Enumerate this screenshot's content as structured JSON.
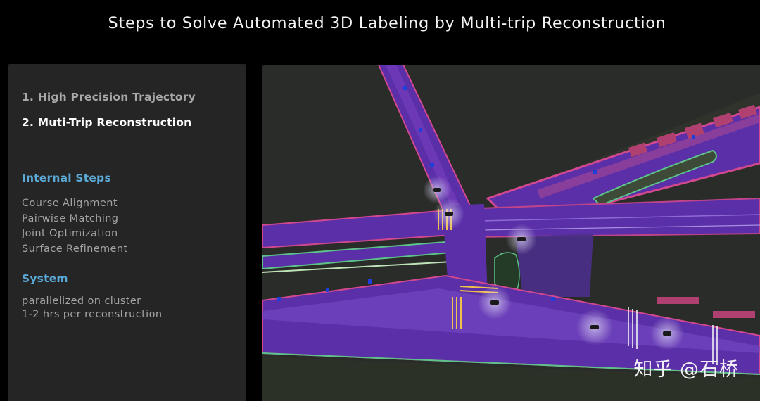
{
  "title": "Steps to Solve Automated 3D Labeling by Multi-trip Reconstruction",
  "steps": [
    {
      "label": "1. High Precision Trajectory",
      "active": false
    },
    {
      "label": "2. Muti-Trip Reconstruction",
      "active": true
    }
  ],
  "internal_steps": {
    "heading": "Internal Steps",
    "items": [
      "Course Alignment",
      "Pairwise Matching",
      "Joint Optimization",
      "Surface Refinement"
    ]
  },
  "system": {
    "heading": "System",
    "items": [
      "parallelized on cluster",
      "1-2 hrs per reconstruction"
    ]
  },
  "watermark": "知乎 @石桥",
  "colors": {
    "background": "#000000",
    "panel": "#252525",
    "accent": "#5aa9d6",
    "road": "#5a2fa8",
    "curb": "#d1488f",
    "ground": "#2a2c29"
  }
}
